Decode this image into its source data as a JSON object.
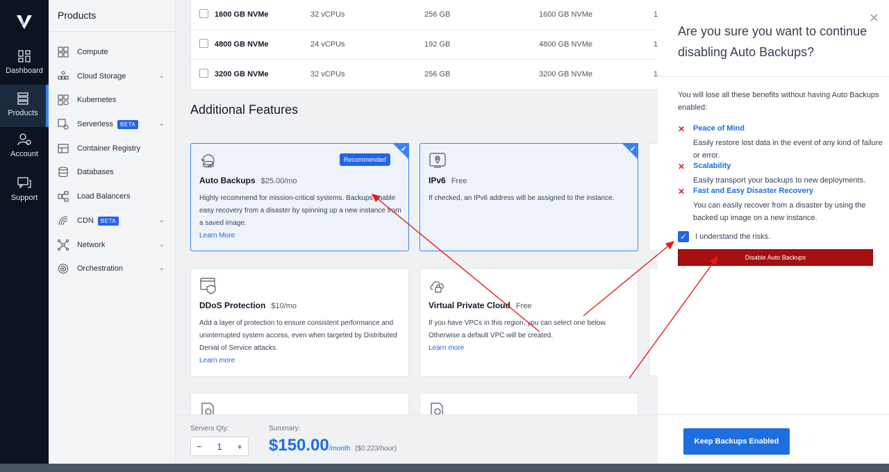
{
  "rail": {
    "items": [
      {
        "label": "Dashboard"
      },
      {
        "label": "Products"
      },
      {
        "label": "Account"
      },
      {
        "label": "Support"
      }
    ]
  },
  "panel": {
    "title": "Products",
    "items": [
      {
        "label": "Compute"
      },
      {
        "label": "Cloud Storage"
      },
      {
        "label": "Kubernetes"
      },
      {
        "label": "Serverless",
        "badge": "BETA"
      },
      {
        "label": "Container Registry"
      },
      {
        "label": "Databases"
      },
      {
        "label": "Load Balancers"
      },
      {
        "label": "CDN",
        "badge": "BETA"
      },
      {
        "label": "Network"
      },
      {
        "label": "Orchestration"
      }
    ]
  },
  "server_table": {
    "rows": [
      {
        "storage": "1600 GB NVMe",
        "cpu": "32 vCPUs",
        "ram": "256 GB",
        "disk": "1600 GB NVMe",
        "extra": "1"
      },
      {
        "storage": "4800 GB NVMe",
        "cpu": "24 vCPUs",
        "ram": "192 GB",
        "disk": "4800 GB NVMe",
        "extra": "1"
      },
      {
        "storage": "3200 GB NVMe",
        "cpu": "32 vCPUs",
        "ram": "256 GB",
        "disk": "3200 GB NVMe",
        "extra": "1"
      }
    ]
  },
  "features": {
    "title": "Additional Features",
    "cards": [
      {
        "title": "Auto Backups",
        "price": "$25.00/mo",
        "badge": "Recommended",
        "desc": "Highly recommend for mission-critical systems. Backups enable easy recovery from a disaster by spinning up a new instance from a saved image.",
        "link": "Learn More",
        "selected": true
      },
      {
        "title": "IPv6",
        "price": "Free",
        "desc": "If checked, an IPv6 address will be assigned to the instance.",
        "selected": true
      },
      {
        "title": "DDoS Protection",
        "price": "$10/mo",
        "desc": "Add a layer of protection to ensure consistent performance and uninterrupted system access, even when targeted by Distributed Denial of Service attacks.",
        "link": "Learn more",
        "selected": false
      },
      {
        "title": "Virtual Private Cloud",
        "price": "Free",
        "desc": "If you have VPCs in this region, you can select one below. Otherwise a default VPC will be created.",
        "link": "Learn more",
        "selected": false
      }
    ]
  },
  "bottom": {
    "qty_label": "Servers Qty:",
    "qty_value": "1",
    "minus": "−",
    "plus": "+",
    "summary_label": "Summary:",
    "price": "$150.00",
    "price_unit": "/month",
    "price_hour": "($0.223/hour)"
  },
  "modal": {
    "title": "Are you sure you want to continue disabling Auto Backups?",
    "close": "✕",
    "intro": "You will lose all these benefits without having Auto Backups enabled:",
    "benefits": [
      {
        "title": "Peace of Mind",
        "desc": "Easily restore lost data in the event of any kind of failure or error."
      },
      {
        "title": "Scalability",
        "desc": "Easily transport your backups to new deployments."
      },
      {
        "title": "Fast and Easy Disaster Recovery",
        "desc": "You can easily recover from a disaster by using the backed up image on a new instance."
      }
    ],
    "checkbox_label": "I understand the risks.",
    "checkbox_checked": true,
    "disable_button": "Disable Auto Backups",
    "keep_button": "Keep Backups Enabled"
  },
  "colors": {
    "accent": "#1d6fe0",
    "danger": "#a50f0f",
    "annotation": "#e51b1b"
  }
}
